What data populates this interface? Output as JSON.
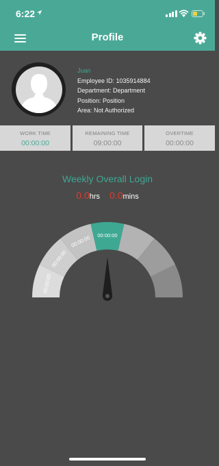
{
  "status_bar": {
    "time": "6:22"
  },
  "header": {
    "title": "Profile"
  },
  "profile": {
    "name": "Juan",
    "employee_id": "Employee ID: 1035914884",
    "department": "Department: Department",
    "position": "Position: Position",
    "area": "Area: Not Authorized"
  },
  "stats": [
    {
      "label": "WORK TIME",
      "value": "00:00:00"
    },
    {
      "label": "REMAINING TIME",
      "value": "09:00:00"
    },
    {
      "label": "OVERTIME",
      "value": "00:00:00"
    }
  ],
  "weekly": {
    "title": "Weekly Overall Login",
    "hours": "0.0",
    "hours_unit": "hrs",
    "minutes": "0.0",
    "minutes_unit": "mins"
  },
  "gauge": {
    "segments": [
      {
        "label": "00:00:00",
        "color": "#dcdcdc"
      },
      {
        "label": "00:00:00",
        "color": "#cfcfcf"
      },
      {
        "label": "00:00:00",
        "color": "#c3c3c3"
      },
      {
        "label": "00:00:00",
        "color": "#3ea893"
      },
      {
        "label": "",
        "color": "#b3b3b3"
      },
      {
        "label": "",
        "color": "#9d9d9d"
      },
      {
        "label": "",
        "color": "#8a8a8a"
      }
    ]
  },
  "colors": {
    "accent": "#4aa996",
    "alert": "#e03b2e",
    "background": "#4a4a4a"
  }
}
